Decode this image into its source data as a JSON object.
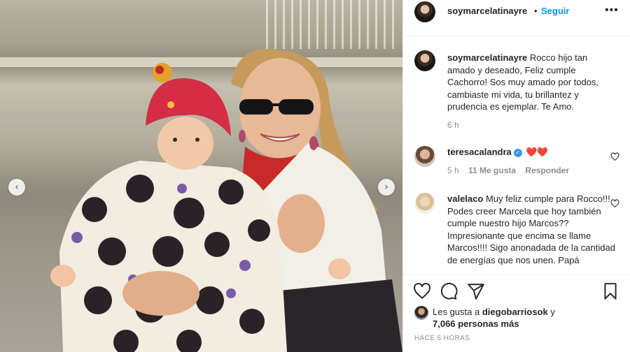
{
  "post": {
    "username": "soymarcelatinayre",
    "separator": "•",
    "follow_label": "Seguir",
    "more_label": "•••",
    "caption": "Rocco hijo tan amado y deseado, Feliz cumple Cachorro! Sos muy amado por todos, cambiaste mi vida, tu brillantez y prudencia es ejemplar. Te Amo.",
    "caption_age": "6 h"
  },
  "comments": [
    {
      "username": "teresacalandra",
      "verified": true,
      "text": "❤️❤️",
      "age": "5 h",
      "likes": "11 Me gusta",
      "reply_label": "Responder"
    },
    {
      "username": "valelaco",
      "verified": false,
      "text": "Muy feliz cumple para Rocco!!! Podes creer Marcela que hoy también cumple nuestro hijo Marcos?? Impresionante que encima se llame Marcos!!!! Sigo anonadada de la cantidad de energías que nos unen. Papá"
    }
  ],
  "likes": {
    "prefix": "Les gusta a",
    "user": "diegobarriosok",
    "suffix": "y",
    "count_text": "7,066 personas más"
  },
  "timestamp": "HACE 6 HORAS",
  "icons": {
    "like": "heart-icon",
    "comment": "comment-icon",
    "share": "share-icon",
    "save": "bookmark-icon",
    "prev": "chevron-left-icon",
    "next": "chevron-right-icon"
  },
  "colors": {
    "follow": "#0095f6",
    "verified": "#3897f0",
    "heart": "#ed4956",
    "muted": "#8e8e8e"
  }
}
